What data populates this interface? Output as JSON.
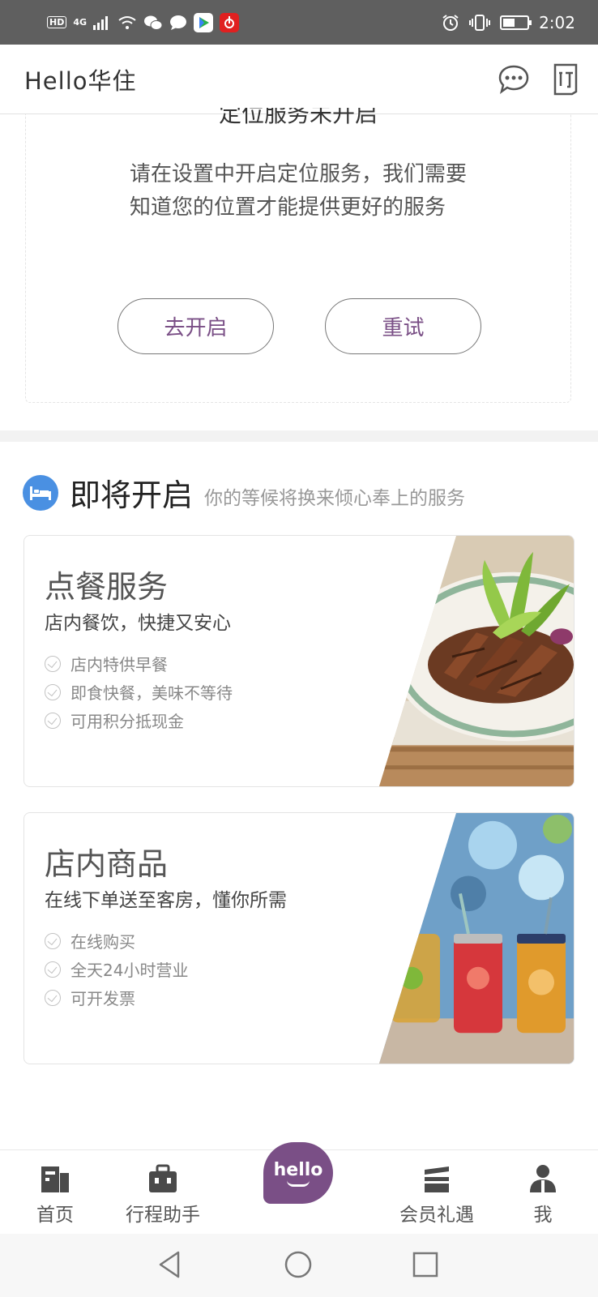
{
  "status_bar": {
    "left_chips": [
      "HD",
      "4G"
    ],
    "time": "2:02",
    "battery_level": 0.5,
    "app_colors": [
      "#ffffff",
      "#e02020"
    ]
  },
  "header": {
    "title": "Hello华住"
  },
  "location_notice": {
    "title": "定位服务未开启",
    "message": "请在设置中开启定位服务，我们需要知道您的位置才能提供更好的服务",
    "open_label": "去开启",
    "retry_label": "重试"
  },
  "section": {
    "title": "即将开启",
    "subtitle": "你的等候将换来倾心奉上的服务",
    "icon_color": "#4a90e2"
  },
  "cards": [
    {
      "title": "点餐服务",
      "subtitle": "店内餐饮，快捷又安心",
      "features": [
        "店内特供早餐",
        "即食快餐，美味不等待",
        "可用积分抵现金"
      ]
    },
    {
      "title": "店内商品",
      "subtitle": "在线下单送至客房，懂你所需",
      "features": [
        "在线购买",
        "全天24小时营业",
        "可开发票"
      ]
    }
  ],
  "bottom_nav": {
    "home": "首页",
    "trip": "行程助手",
    "hello": "hello",
    "member": "会员礼遇",
    "me": "我",
    "brand_color": "#7a4f86"
  }
}
